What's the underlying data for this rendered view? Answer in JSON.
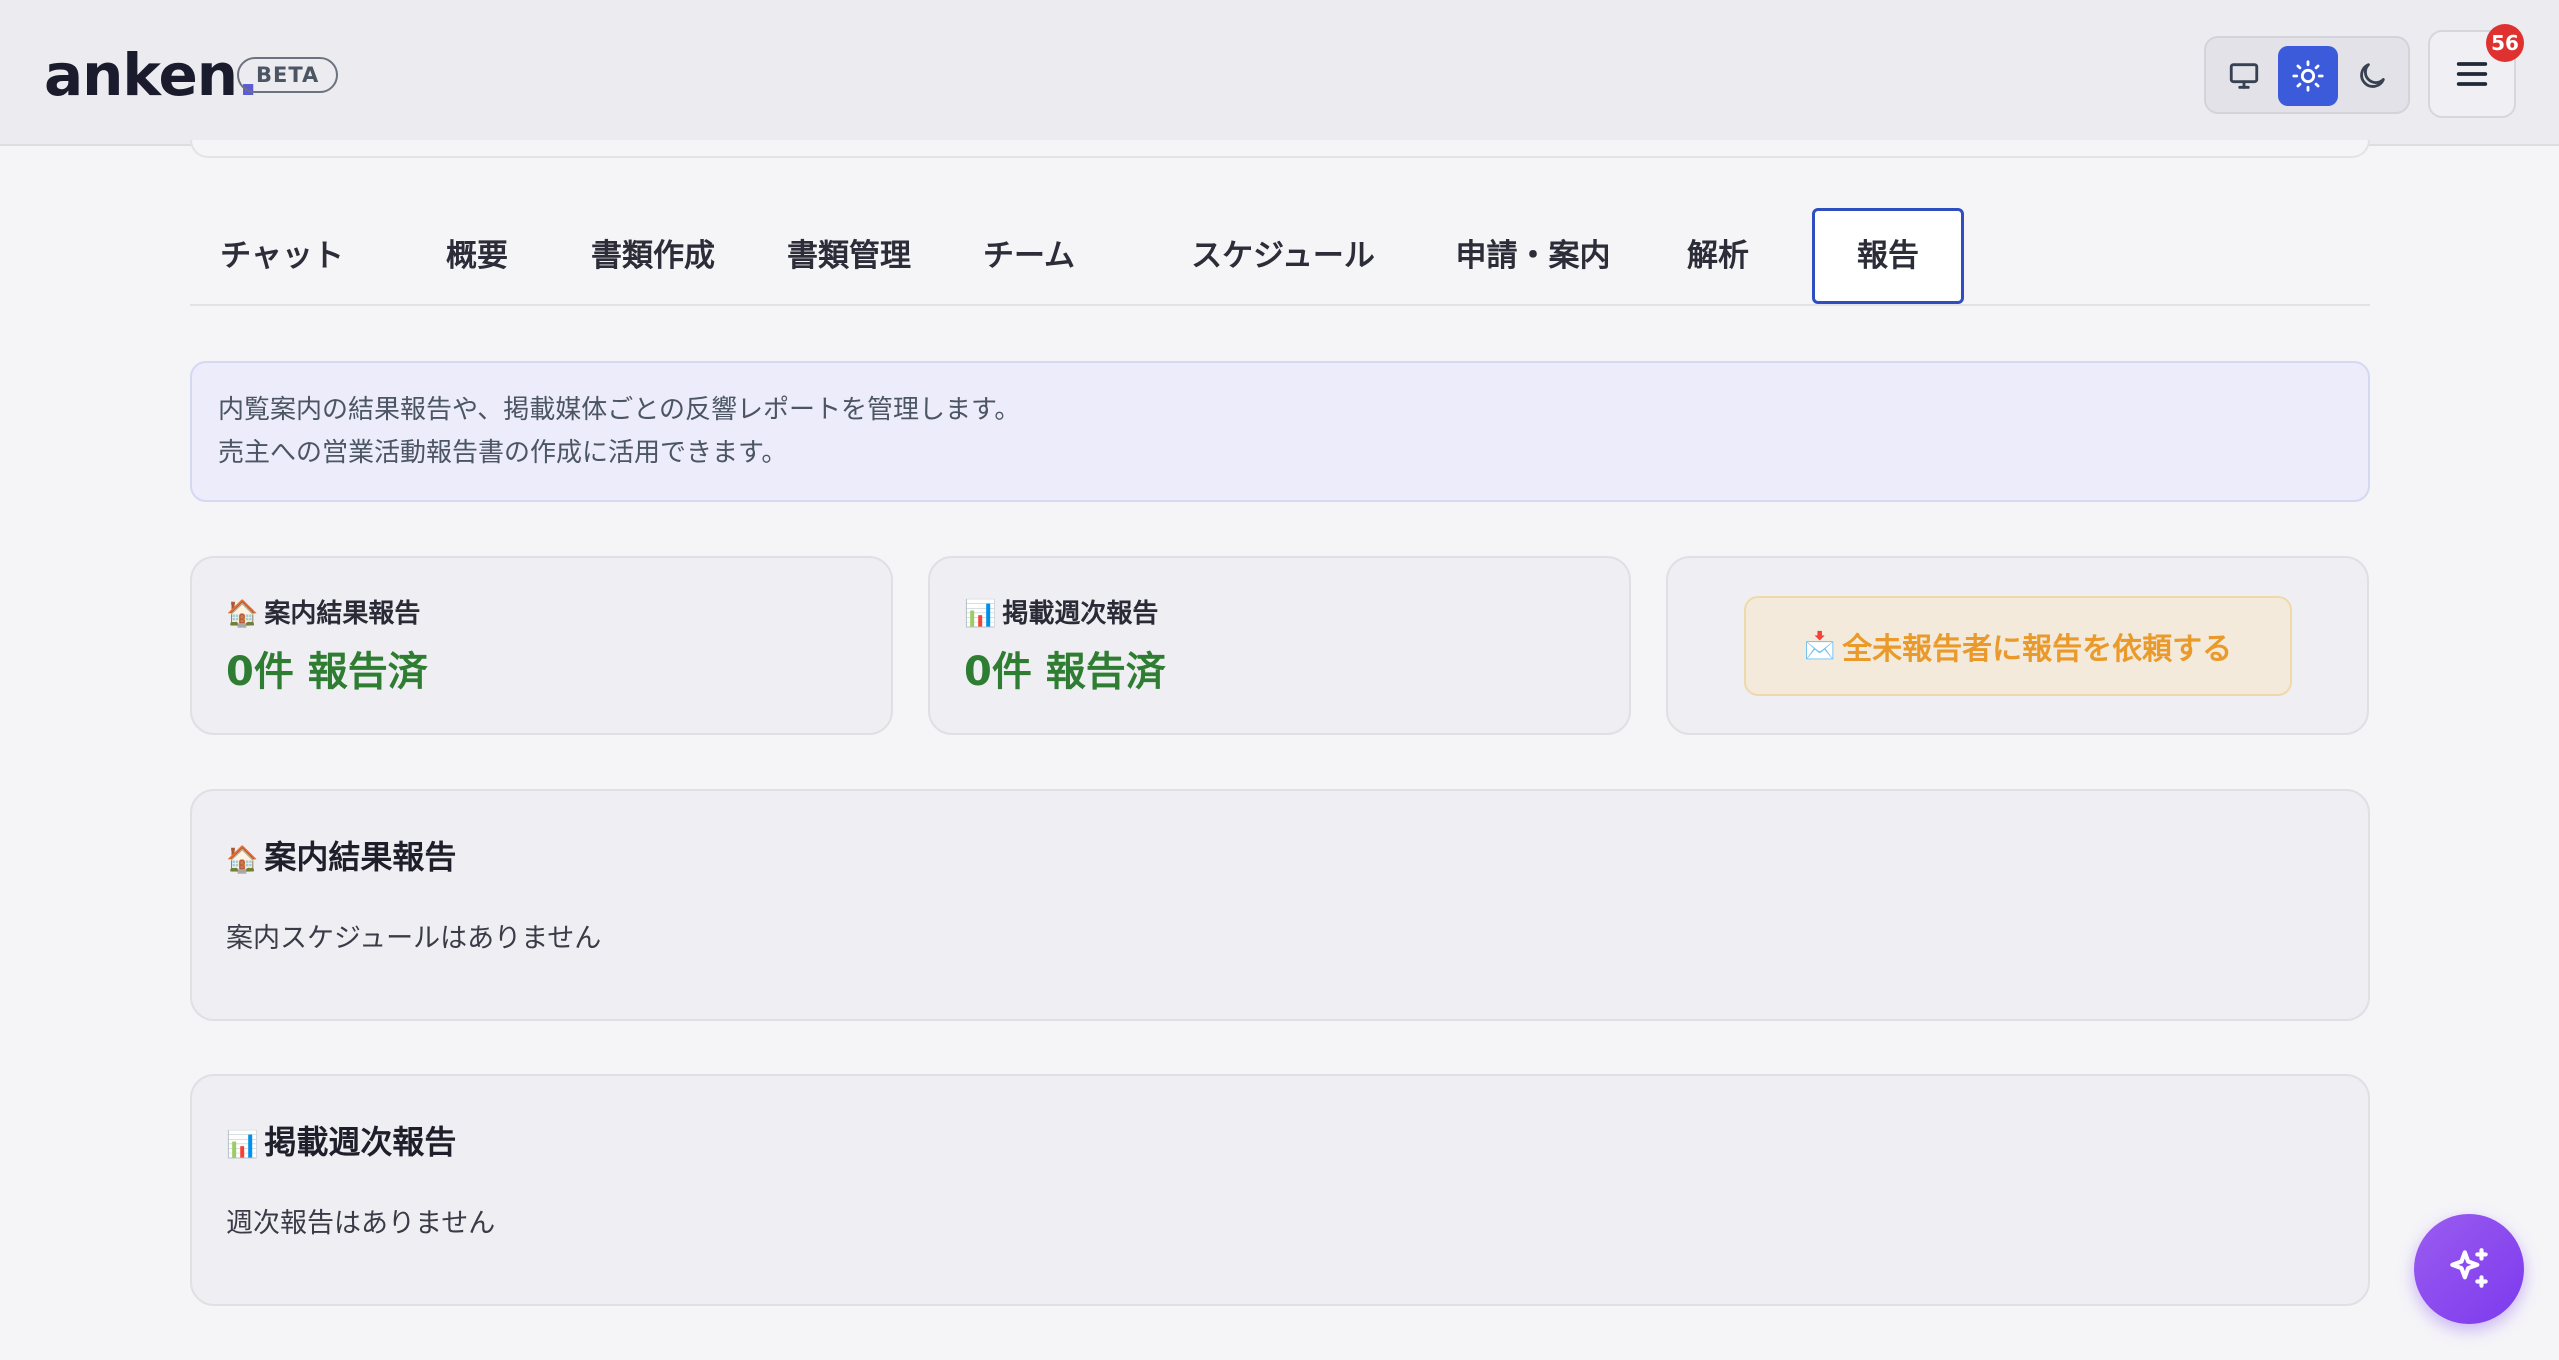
{
  "header": {
    "logo_text": "anken",
    "logo_dot": ".",
    "beta_label": "BETA",
    "theme_buttons": [
      {
        "icon": "monitor-icon"
      },
      {
        "icon": "sun-icon",
        "selected": true
      },
      {
        "icon": "moon-icon"
      }
    ],
    "menu_icon": "hamburger-menu-icon",
    "notification_count": "56"
  },
  "tabs": [
    {
      "label": "チャット"
    },
    {
      "label": "概要"
    },
    {
      "label": "書類作成"
    },
    {
      "label": "書類管理"
    },
    {
      "label": "チーム"
    },
    {
      "label": "スケジュール"
    },
    {
      "label": "申請・案内"
    },
    {
      "label": "解析"
    },
    {
      "label": "報告",
      "active": true
    }
  ],
  "info": {
    "line1": "内覧案内の結果報告や、掲載媒体ごとの反響レポートを管理します。",
    "line2": "売主への営業活動報告書の作成に活用できます。"
  },
  "stats": {
    "guide_report": {
      "emoji": "🏠",
      "label": "案内結果報告",
      "value": "0件 報告済"
    },
    "weekly_report": {
      "emoji": "📊",
      "label": "掲載週次報告",
      "value": "0件 報告済"
    },
    "request_button": {
      "emoji": "📩",
      "label": "全未報告者に報告を依頼する"
    }
  },
  "sections": {
    "guide": {
      "emoji": "🏠",
      "title": "案内結果報告",
      "empty_text": "案内スケジュールはありません"
    },
    "weekly": {
      "emoji": "📊",
      "title": "掲載週次報告",
      "empty_text": "週次報告はありません"
    }
  },
  "fab": {
    "icon": "sparkles-icon"
  },
  "colors": {
    "accent": "#3b5bdb",
    "success": "#2f7d32",
    "warning_text": "#ea9a2a",
    "badge": "#e03131",
    "fab": "#7c3aed"
  }
}
